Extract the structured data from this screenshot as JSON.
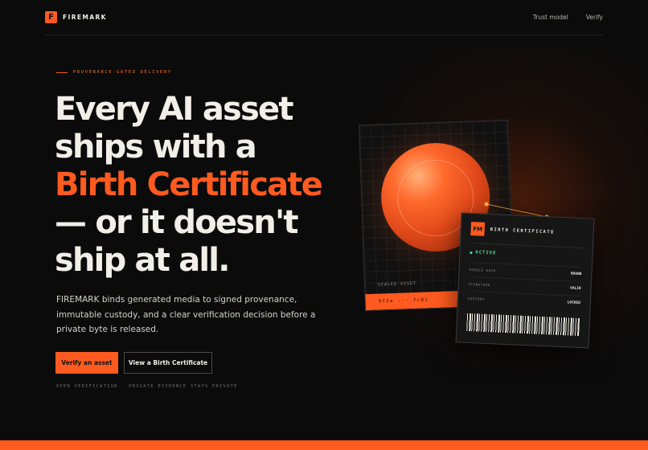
{
  "header": {
    "logo_glyph": "F",
    "brand": "FIREMARK",
    "nav": [
      {
        "label": "Trust model"
      },
      {
        "label": "Verify"
      }
    ]
  },
  "hero": {
    "eyebrow": "PROVENANCE-GATED DELIVERY",
    "headline_line1": "Every AI asset",
    "headline_line2": "ships with a",
    "headline_accent": "Birth Certificate",
    "headline_line4": "— or it doesn't",
    "headline_line5": "ship at all.",
    "lede": "FIREMARK binds generated media to signed provenance, immutable custody, and a clear verification decision before a private byte is released.",
    "primary_cta": "Verify an asset",
    "secondary_cta": "View a Birth Certificate",
    "footnote": "OPEN VERIFICATION · PRIVATE EVIDENCE STAYS PRIVATE"
  },
  "asset_card": {
    "label": "SEALED ASSET",
    "hash": "9f2a ··· 7c81"
  },
  "certificate": {
    "logo": "FM",
    "title": "BIRTH CERTIFICATE",
    "status": "ACTIVE",
    "rows": [
      {
        "key": "SOURCE HASH",
        "value": "BOUND"
      },
      {
        "key": "SIGNATURE",
        "value": "VALID"
      },
      {
        "key": "CUSTODY",
        "value": "LOCKED"
      }
    ]
  },
  "colors": {
    "accent": "#ff5a1f",
    "background": "#0b0b0b",
    "status_active": "#4fe0a3"
  }
}
